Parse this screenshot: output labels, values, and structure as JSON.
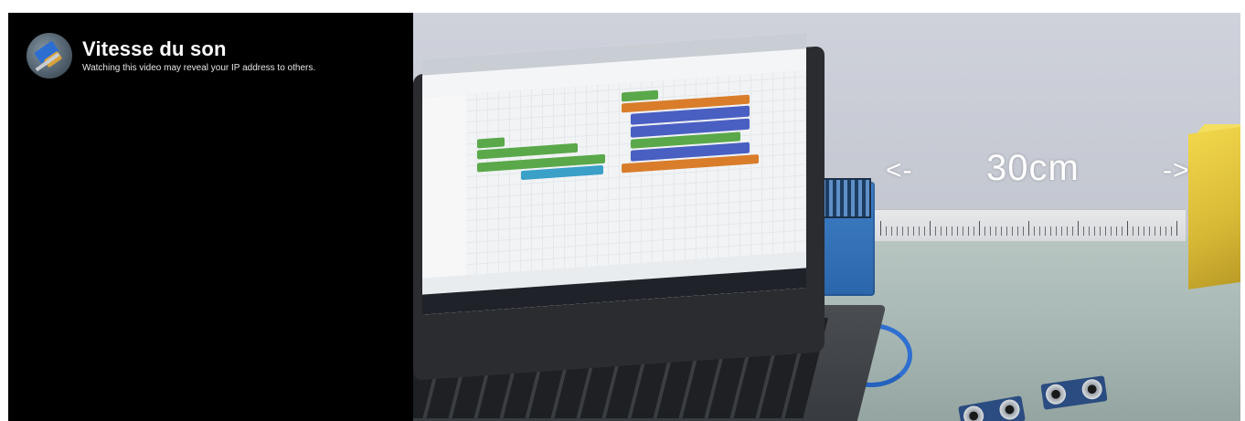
{
  "video": {
    "title": "Vitesse du son",
    "privacy_notice": "Watching this video may reveal your IP address to others."
  },
  "scene": {
    "arrow_left": "<-",
    "distance": "30cm",
    "arrow_right": "->"
  },
  "icons": {
    "channel_avatar": "channel-avatar-icon"
  },
  "colors": {
    "background": "#000000",
    "title_text": "#ffffff",
    "overlay_text": "#ffffff"
  }
}
